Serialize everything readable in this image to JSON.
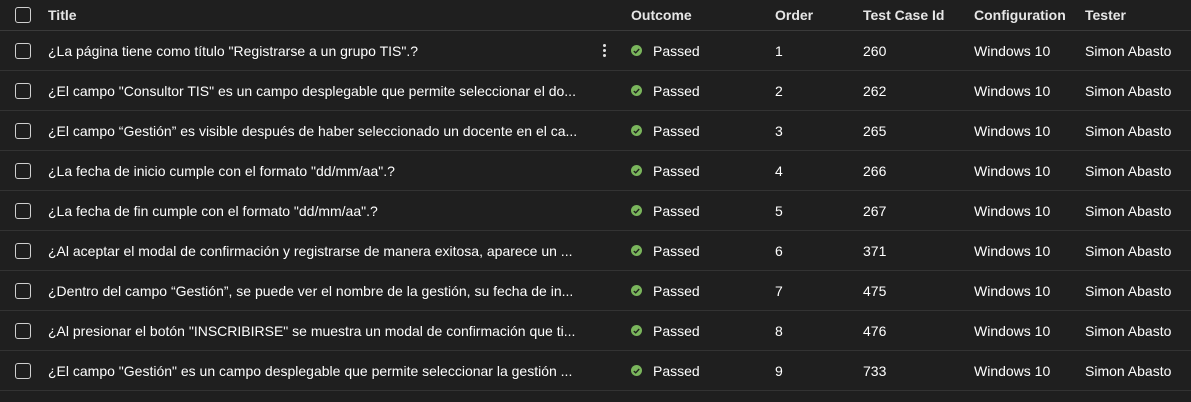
{
  "columns": {
    "title": "Title",
    "outcome": "Outcome",
    "order": "Order",
    "test_case_id": "Test Case Id",
    "configuration": "Configuration",
    "tester": "Tester"
  },
  "status_icon": "check-circle-icon",
  "status_color": "#7ab55c",
  "more_icon": "more-vertical-icon",
  "rows": [
    {
      "title": "¿La página tiene como título \"Registrarse a un grupo TIS\".?",
      "outcome": "Passed",
      "order": "1",
      "test_case_id": "260",
      "configuration": "Windows 10",
      "tester": "Simon Abasto"
    },
    {
      "title": "¿El campo \"Consultor TIS\" es un campo desplegable que permite seleccionar el do...",
      "outcome": "Passed",
      "order": "2",
      "test_case_id": "262",
      "configuration": "Windows 10",
      "tester": "Simon Abasto"
    },
    {
      "title": "¿El campo “Gestión” es visible después de haber seleccionado un docente en el ca...",
      "outcome": "Passed",
      "order": "3",
      "test_case_id": "265",
      "configuration": "Windows 10",
      "tester": "Simon Abasto"
    },
    {
      "title": "¿La fecha de inicio cumple con el formato \"dd/mm/aa\".?",
      "outcome": "Passed",
      "order": "4",
      "test_case_id": "266",
      "configuration": "Windows 10",
      "tester": "Simon Abasto"
    },
    {
      "title": "¿La fecha de fin cumple con el formato \"dd/mm/aa\".?",
      "outcome": "Passed",
      "order": "5",
      "test_case_id": "267",
      "configuration": "Windows 10",
      "tester": "Simon Abasto"
    },
    {
      "title": "¿Al aceptar el modal de confirmación y registrarse de manera exitosa, aparece un ...",
      "outcome": "Passed",
      "order": "6",
      "test_case_id": "371",
      "configuration": "Windows 10",
      "tester": "Simon Abasto"
    },
    {
      "title": "¿Dentro del campo “Gestión”, se puede ver el nombre de la gestión, su fecha de in...",
      "outcome": "Passed",
      "order": "7",
      "test_case_id": "475",
      "configuration": "Windows 10",
      "tester": "Simon Abasto"
    },
    {
      "title": "¿Al presionar el botón \"INSCRIBIRSE\" se muestra un modal de confirmación que ti...",
      "outcome": "Passed",
      "order": "8",
      "test_case_id": "476",
      "configuration": "Windows 10",
      "tester": "Simon Abasto"
    },
    {
      "title": "¿El campo \"Gestión\" es un campo desplegable que permite seleccionar la gestión ...",
      "outcome": "Passed",
      "order": "9",
      "test_case_id": "733",
      "configuration": "Windows 10",
      "tester": "Simon Abasto"
    }
  ]
}
